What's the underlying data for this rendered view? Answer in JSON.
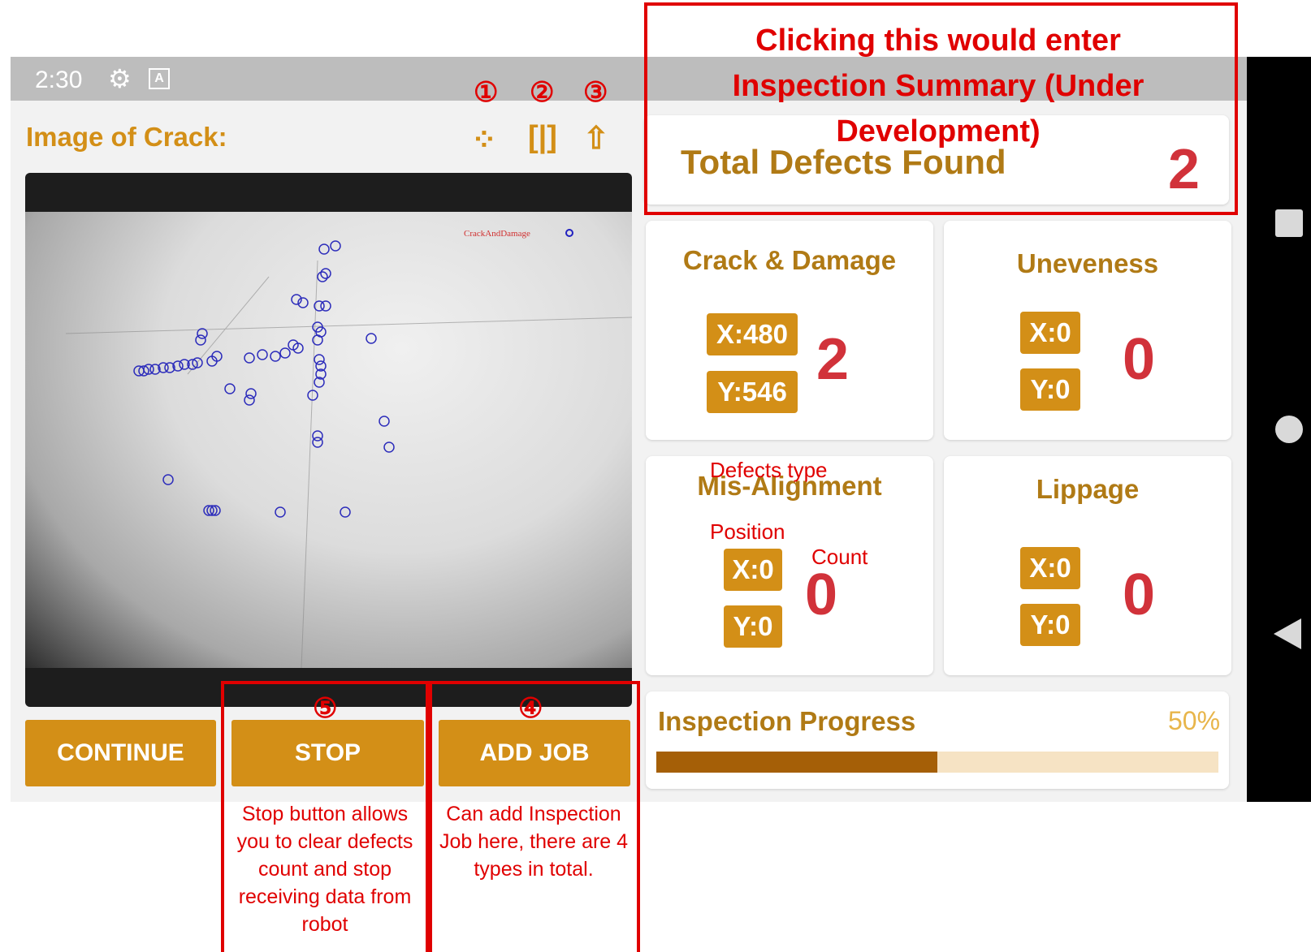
{
  "statusbar": {
    "time": "2:30",
    "settings_icon": "gear-icon",
    "app_icon_letter": "A"
  },
  "left": {
    "title": "Image of Crack:",
    "toolbar_icons": [
      "points-icon",
      "split-view-icon",
      "share-icon"
    ],
    "overlay_legend": "CrackAndDamage"
  },
  "buttons": {
    "continue": "CONTINUE",
    "stop": "STOP",
    "add_job": "ADD JOB"
  },
  "total": {
    "label": "Total Defects Found",
    "count": "2"
  },
  "defects": [
    {
      "title": "Crack & Damage",
      "x": "X:480",
      "y": "Y:546",
      "count": "2"
    },
    {
      "title": "Uneveness",
      "x": "X:0",
      "y": "Y:0",
      "count": "0"
    },
    {
      "title": "Mis-Alignment",
      "x": "X:0",
      "y": "Y:0",
      "count": "0"
    },
    {
      "title": "Lippage",
      "x": "X:0",
      "y": "Y:0",
      "count": "0"
    }
  ],
  "progress": {
    "label": "Inspection Progress",
    "percent_text": "50%",
    "value": 0.5
  },
  "annotations": {
    "summary_text_line1": "Clicking this would enter",
    "summary_text_line2": "Inspection Summary (Under",
    "summary_text_line3": "Development)",
    "markers": [
      "①",
      "②",
      "③",
      "④",
      "⑤"
    ],
    "stop_note": "Stop button allows you to clear defects count and stop receiving data from robot",
    "addjob_note": "Can add Inspection Job here, there are 4 types in total.",
    "defects_type": "Defects type",
    "position": "Position",
    "count": "Count"
  },
  "colors": {
    "accent": "#d38f17",
    "title": "#b07a15",
    "count": "#d1323a",
    "annotation": "#e00000",
    "progress_fill": "#a55f07",
    "progress_track": "#f6e3c4"
  }
}
